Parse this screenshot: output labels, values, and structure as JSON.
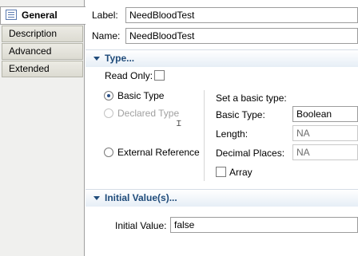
{
  "tabs": [
    {
      "label": "General",
      "active": true
    },
    {
      "label": "Description",
      "active": false
    },
    {
      "label": "Advanced",
      "active": false
    },
    {
      "label": "Extended",
      "active": false
    }
  ],
  "form": {
    "label_caption": "Label:",
    "label_value": "NeedBloodTest",
    "name_caption": "Name:",
    "name_value": "NeedBloodTest"
  },
  "type_section": {
    "title": "Type...",
    "read_only_label": "Read Only:",
    "read_only_checked": false,
    "basic_type_radio": "Basic Type",
    "declared_type_radio": "Declared Type",
    "external_reference_radio": "External Reference",
    "selected_radio": "Basic Type",
    "set_basic_type_caption": "Set a basic type:",
    "basic_type_label": "Basic Type:",
    "basic_type_value": "Boolean",
    "length_label": "Length:",
    "length_value": "NA",
    "decimal_places_label": "Decimal Places:",
    "decimal_places_value": "NA",
    "array_label": "Array",
    "array_checked": false
  },
  "initial_section": {
    "title": "Initial Value(s)...",
    "initial_value_label": "Initial Value:",
    "initial_value": "false"
  },
  "colors": {
    "section_title": "#1f4b7a",
    "tab_active_bg": "#ffffff",
    "tab_inactive_bg": "#dcdbd2"
  }
}
